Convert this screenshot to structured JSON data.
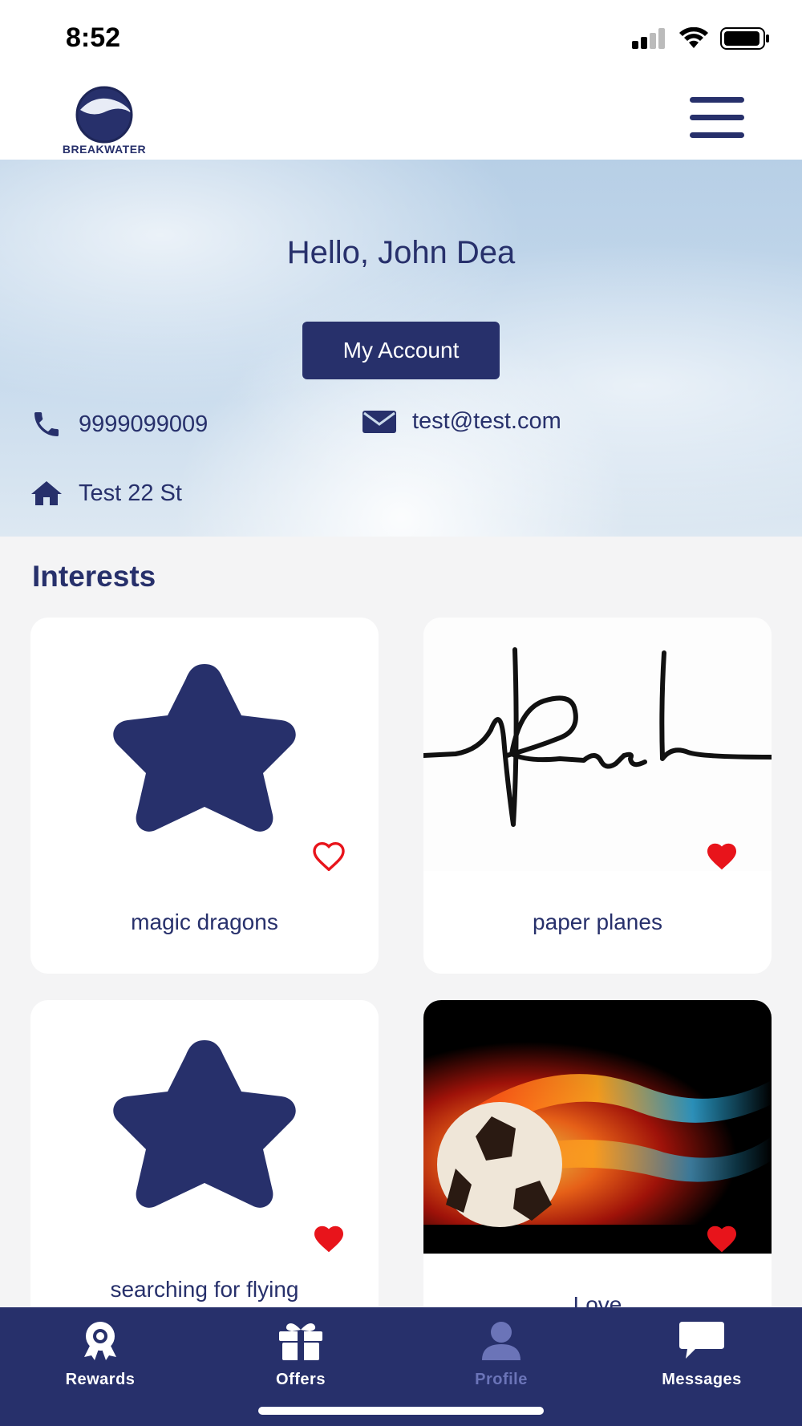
{
  "status": {
    "time": "8:52"
  },
  "header": {
    "logo_text": "BREAKWATER"
  },
  "profile": {
    "greeting": "Hello, John Dea",
    "account_button": "My Account",
    "phone": "9999099009",
    "email": "test@test.com",
    "address": "Test 22 St"
  },
  "interests": {
    "title": "Interests",
    "items": [
      {
        "label": "magic dragons",
        "image": "star-icon",
        "favorited": false
      },
      {
        "label": "paper planes",
        "image": "signature-image",
        "favorited": true
      },
      {
        "label": "searching for flying",
        "image": "star-icon",
        "favorited": true
      },
      {
        "label": "Love",
        "image": "flaming-soccer-ball-image",
        "favorited": true
      }
    ]
  },
  "nav": {
    "items": [
      {
        "label": "Rewards",
        "icon": "award-ribbon-icon"
      },
      {
        "label": "Offers",
        "icon": "gift-icon"
      },
      {
        "label": "Profile",
        "icon": "user-icon",
        "active": true
      },
      {
        "label": "Messages",
        "icon": "chat-bubble-icon"
      }
    ]
  },
  "colors": {
    "primary": "#27306b",
    "heart": "#e8141b",
    "nav_active": "#6b74b8"
  }
}
